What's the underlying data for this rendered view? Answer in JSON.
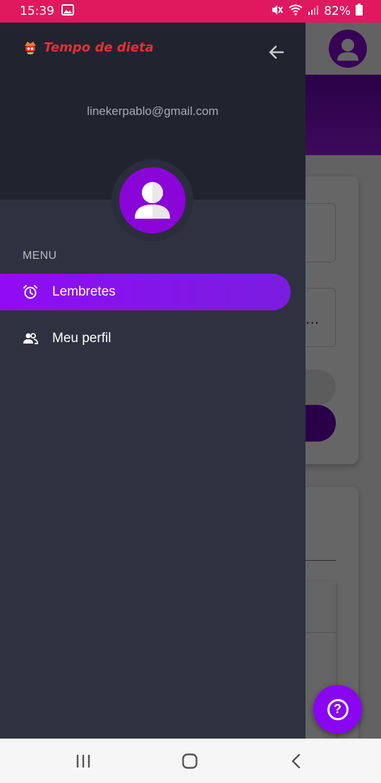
{
  "status_bar": {
    "time": "15:39",
    "battery": "82%",
    "icons": [
      "gallery-icon",
      "mute-icon",
      "wifi-icon",
      "signal-icon",
      "battery-icon"
    ]
  },
  "drawer": {
    "brand_name": "Tempo de dieta",
    "email": "linekerpablo@gmail.com",
    "menu_heading": "MENU",
    "items": [
      {
        "label": "Lembretes",
        "icon": "alarm-clock-icon",
        "active": true
      },
      {
        "label": "Meu perfil",
        "icon": "people-icon",
        "active": false
      }
    ]
  },
  "background": {
    "ellipsis": "..."
  },
  "help_button": {
    "label": "?"
  },
  "colors": {
    "status_bar": "#e0195f",
    "accent": "#8a05f2",
    "drawer": "#2e3240",
    "drawer_header": "#21242e",
    "brand": "#e0313a"
  }
}
